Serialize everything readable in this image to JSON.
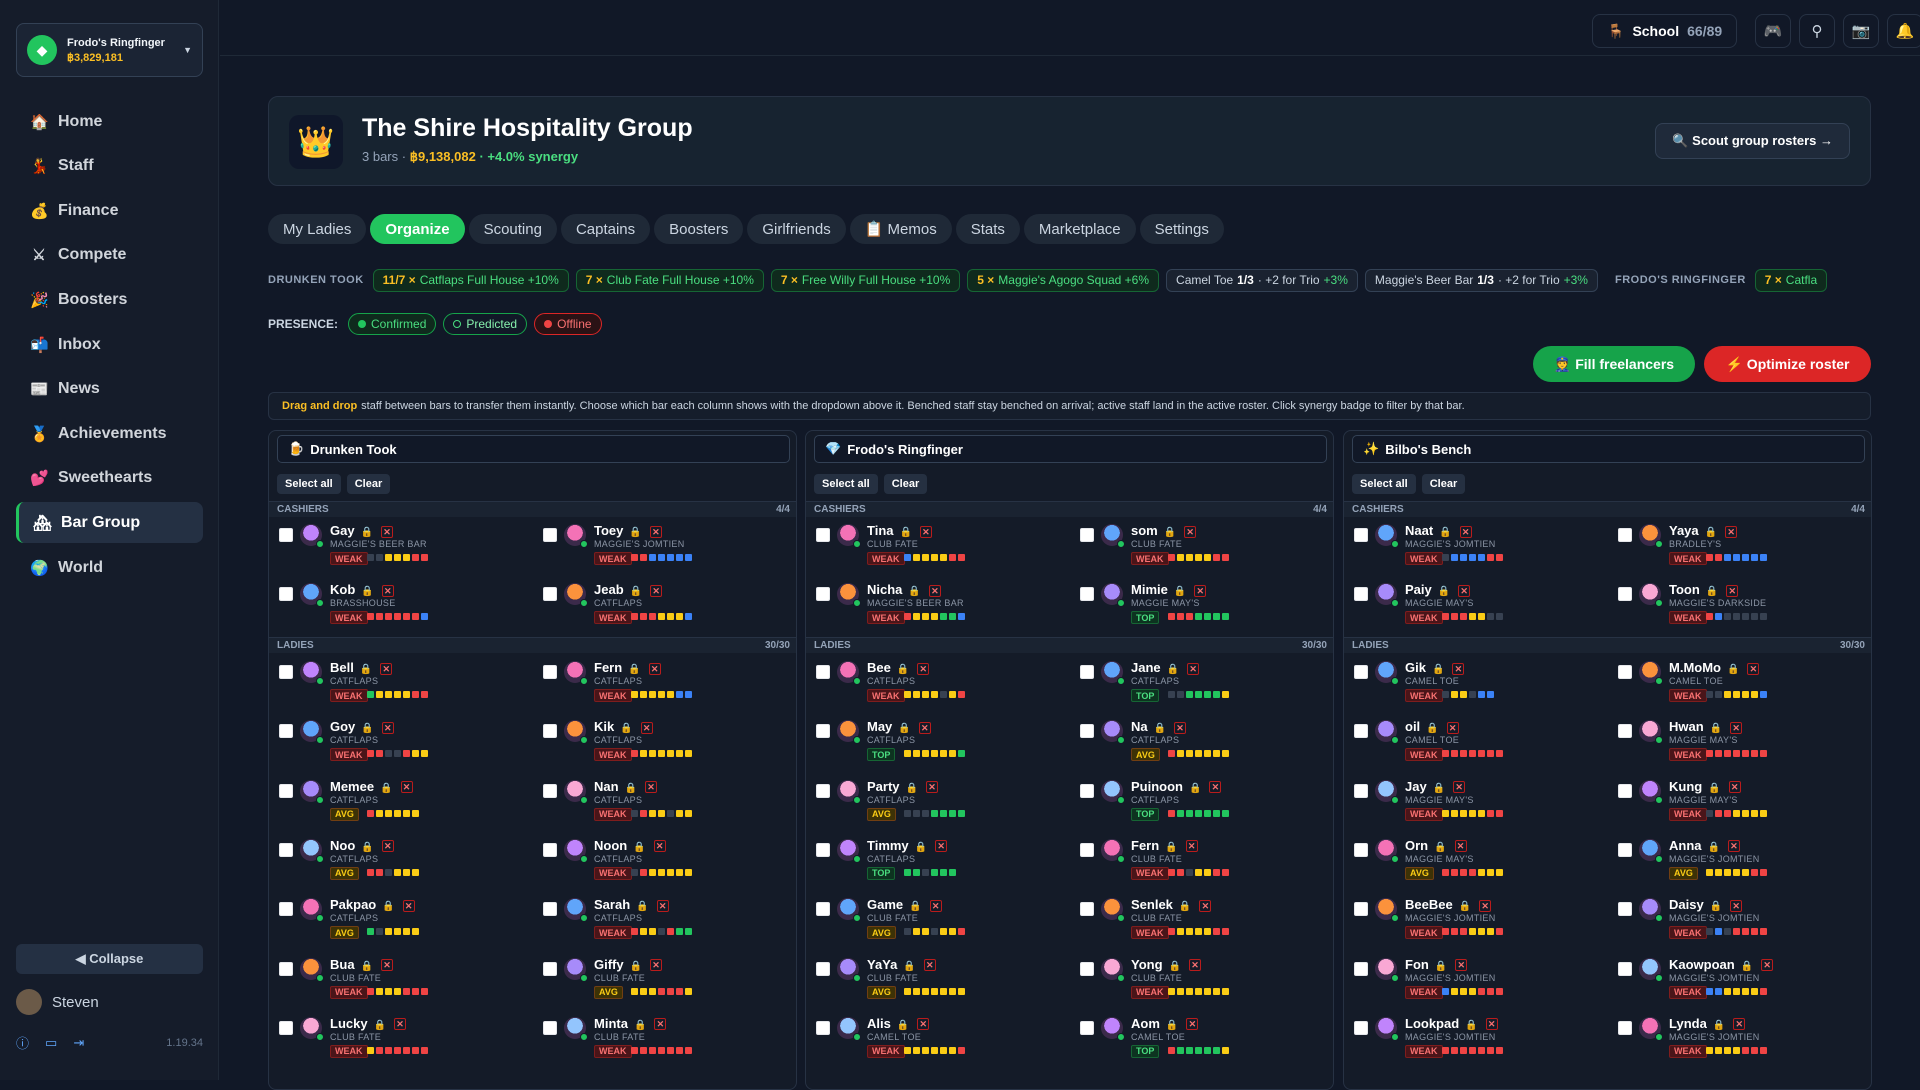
{
  "account": {
    "name": "Frodo's Ringfinger",
    "balance": "฿3,829,181"
  },
  "nav": [
    {
      "label": "Home",
      "icon": "🏠"
    },
    {
      "label": "Staff",
      "icon": "💃"
    },
    {
      "label": "Finance",
      "icon": "💰"
    },
    {
      "label": "Compete",
      "icon": "⚔"
    },
    {
      "label": "Boosters",
      "icon": "🎉"
    },
    {
      "label": "Inbox",
      "icon": "📬"
    },
    {
      "label": "News",
      "icon": "📰"
    },
    {
      "label": "Achievements",
      "icon": "🏅"
    },
    {
      "label": "Sweethearts",
      "icon": "💕"
    },
    {
      "label": "Bar Group",
      "icon": "🏘",
      "active": true
    },
    {
      "label": "World",
      "icon": "🌍"
    }
  ],
  "sidebar": {
    "collapse": "◀ Collapse",
    "user": "Steven",
    "version": "1.19.34"
  },
  "topbar": {
    "school_label": "School",
    "school_count": "66/89"
  },
  "hero": {
    "title": "The Shire Hospitality Group",
    "bars": "3 bars ·",
    "value": "฿9,138,082",
    "synergy": "· +4.0% synergy",
    "scout": "🔍 Scout group rosters →"
  },
  "tabs": [
    "My Ladies",
    "Organize",
    "Scouting",
    "Captains",
    "Boosters",
    "Girlfriends",
    "📋 Memos",
    "Stats",
    "Marketplace",
    "Settings"
  ],
  "active_tab": "Organize",
  "synergy": {
    "label": "DRUNKEN TOOK",
    "chips": [
      {
        "count": "11/7 ×",
        "name": "Catflaps Full House +10%",
        "type": "full"
      },
      {
        "count": "7 ×",
        "name": "Club Fate Full House +10%",
        "type": "full"
      },
      {
        "count": "7 ×",
        "name": "Free Willy Full House +10%",
        "type": "full"
      },
      {
        "count": "5 ×",
        "name": "Maggie's Agogo Squad +6%",
        "type": "full"
      },
      {
        "name": "Camel Toe",
        "frac": "1/3",
        "rest": "· +2 for Trio",
        "pct": "+3%",
        "type": "part"
      },
      {
        "name": "Maggie's Beer Bar",
        "frac": "1/3",
        "rest": "· +2 for Trio",
        "pct": "+3%",
        "type": "part"
      }
    ],
    "label2": "FRODO'S RINGFINGER",
    "chip2": {
      "count": "7 ×",
      "name": "Catfla"
    }
  },
  "presence": {
    "label": "PRESENCE:",
    "items": [
      "Confirmed",
      "Predicted",
      "Offline"
    ]
  },
  "actions": {
    "fill": "👮 Fill freelancers",
    "optimize": "⚡ Optimize roster"
  },
  "info": {
    "bold": "Drag and drop",
    "text": "staff between bars to transfer them instantly. Choose which bar each column shows with the dropdown above it. Benched staff stay benched on arrival; active staff land in the active roster. Click synergy badge to filter by that bar."
  },
  "columns": [
    {
      "title": "Drunken Took",
      "icon": "🍺",
      "select_all": "Select all",
      "clear": "Clear",
      "cashiers_label": "CASHIERS",
      "cashiers_count": "4/4",
      "ladies_label": "LADIES",
      "ladies_count": "30/30",
      "cashiers": [
        {
          "name": "Gay",
          "bar": "MAGGIE'S BEER BAR",
          "tier": "WEAK",
          "dots": "kkyyyrr"
        },
        {
          "name": "Toey",
          "bar": "MAGGIE'S JOMTIEN",
          "tier": "WEAK",
          "dots": "rrbbbbb"
        },
        {
          "name": "Kob",
          "bar": "BRASSHOUSE",
          "tier": "WEAK",
          "dots": "rrrrrrb"
        },
        {
          "name": "Jeab",
          "bar": "CATFLAPS",
          "tier": "WEAK",
          "dots": "rrryyyb"
        }
      ],
      "ladies": [
        {
          "name": "Bell",
          "bar": "CATFLAPS",
          "tier": "WEAK",
          "dots": "gyyyyrr"
        },
        {
          "name": "Fern",
          "bar": "CATFLAPS",
          "tier": "WEAK",
          "dots": "yyyyybb"
        },
        {
          "name": "Goy",
          "bar": "CATFLAPS",
          "tier": "WEAK",
          "dots": "rrkkryy"
        },
        {
          "name": "Kik",
          "bar": "CATFLAPS",
          "tier": "WEAK",
          "dots": "ryyyyyy"
        },
        {
          "name": "Memee",
          "bar": "CATFLAPS",
          "tier": "AVG",
          "dots": "ryyyyy"
        },
        {
          "name": "Nan",
          "bar": "CATFLAPS",
          "tier": "WEAK",
          "dots": "kryykyy"
        },
        {
          "name": "Noo",
          "bar": "CATFLAPS",
          "tier": "AVG",
          "dots": "rrkyyy"
        },
        {
          "name": "Noon",
          "bar": "CATFLAPS",
          "tier": "WEAK",
          "dots": "kryyyyy"
        },
        {
          "name": "Pakpao",
          "bar": "CATFLAPS",
          "tier": "AVG",
          "dots": "gkyyyy"
        },
        {
          "name": "Sarah",
          "bar": "CATFLAPS",
          "tier": "WEAK",
          "dots": "ryykrgg"
        },
        {
          "name": "Bua",
          "bar": "CLUB FATE",
          "tier": "WEAK",
          "dots": "ryyyrrr"
        },
        {
          "name": "Giffy",
          "bar": "CLUB FATE",
          "tier": "AVG",
          "dots": "yyyrrry"
        },
        {
          "name": "Lucky",
          "bar": "CLUB FATE",
          "tier": "WEAK",
          "dots": "yrrrrrr"
        },
        {
          "name": "Minta",
          "bar": "CLUB FATE",
          "tier": "WEAK",
          "dots": "rrrrrrr"
        }
      ]
    },
    {
      "title": "Frodo's Ringfinger",
      "icon": "💎",
      "select_all": "Select all",
      "clear": "Clear",
      "cashiers_label": "CASHIERS",
      "cashiers_count": "4/4",
      "ladies_label": "LADIES",
      "ladies_count": "30/30",
      "cashiers": [
        {
          "name": "Tina",
          "bar": "CLUB FATE",
          "tier": "WEAK",
          "dots": "byyyyrr"
        },
        {
          "name": "som",
          "bar": "CLUB FATE",
          "tier": "WEAK",
          "dots": "ryyyyrr"
        },
        {
          "name": "Nicha",
          "bar": "MAGGIE'S BEER BAR",
          "tier": "WEAK",
          "dots": "ryyyggb"
        },
        {
          "name": "Mimie",
          "bar": "MAGGIE MAY'S",
          "tier": "TOP",
          "dots": "rrrgggg"
        }
      ],
      "ladies": [
        {
          "name": "Bee",
          "bar": "CATFLAPS",
          "tier": "WEAK",
          "dots": "yyyykyr"
        },
        {
          "name": "Jane",
          "bar": "CATFLAPS",
          "tier": "TOP",
          "dots": "kkggggy"
        },
        {
          "name": "May",
          "bar": "CATFLAPS",
          "tier": "TOP",
          "dots": "yyyyyyg"
        },
        {
          "name": "Na",
          "bar": "CATFLAPS",
          "tier": "AVG",
          "dots": "ryyyyyy"
        },
        {
          "name": "Party",
          "bar": "CATFLAPS",
          "tier": "AVG",
          "dots": "kkkgggg"
        },
        {
          "name": "Puinoon",
          "bar": "CATFLAPS",
          "tier": "TOP",
          "dots": "rgggggg"
        },
        {
          "name": "Timmy",
          "bar": "CATFLAPS",
          "tier": "TOP",
          "dots": "ggkggg"
        },
        {
          "name": "Fern",
          "bar": "CLUB FATE",
          "tier": "WEAK",
          "dots": "rrkyyrr"
        },
        {
          "name": "Game",
          "bar": "CLUB FATE",
          "tier": "AVG",
          "dots": "kyykyyr"
        },
        {
          "name": "Senlek",
          "bar": "CLUB FATE",
          "tier": "WEAK",
          "dots": "ryyyyrr"
        },
        {
          "name": "YaYa",
          "bar": "CLUB FATE",
          "tier": "AVG",
          "dots": "yyyyyyy"
        },
        {
          "name": "Yong",
          "bar": "CLUB FATE",
          "tier": "WEAK",
          "dots": "yyyyyyy"
        },
        {
          "name": "Alis",
          "bar": "CAMEL TOE",
          "tier": "WEAK",
          "dots": "yyyyyyr"
        },
        {
          "name": "Aom",
          "bar": "CAMEL TOE",
          "tier": "TOP",
          "dots": "rgggggy"
        }
      ]
    },
    {
      "title": "Bilbo's Bench",
      "icon": "✨",
      "select_all": "Select all",
      "clear": "Clear",
      "cashiers_label": "CASHIERS",
      "cashiers_count": "4/4",
      "ladies_label": "LADIES",
      "ladies_count": "30/30",
      "cashiers": [
        {
          "name": "Naat",
          "bar": "MAGGIE'S JOMTIEN",
          "tier": "WEAK",
          "dots": "kbbbbrr"
        },
        {
          "name": "Yaya",
          "bar": "BRADLEY'S",
          "tier": "WEAK",
          "dots": "rrbbbbb"
        },
        {
          "name": "Paiy",
          "bar": "MAGGIE MAY'S",
          "tier": "WEAK",
          "dots": "rrryykk"
        },
        {
          "name": "Toon",
          "bar": "MAGGIE'S DARKSIDE",
          "tier": "WEAK",
          "dots": "rbkkkkk"
        }
      ],
      "ladies": [
        {
          "name": "Gik",
          "bar": "CAMEL TOE",
          "tier": "WEAK",
          "dots": "kyykbb"
        },
        {
          "name": "M.MoMo",
          "bar": "CAMEL TOE",
          "tier": "WEAK",
          "dots": "kkyyyyb"
        },
        {
          "name": "oil",
          "bar": "CAMEL TOE",
          "tier": "WEAK",
          "dots": "rrrrrrr"
        },
        {
          "name": "Hwan",
          "bar": "MAGGIE MAY'S",
          "tier": "WEAK",
          "dots": "rrrrrrr"
        },
        {
          "name": "Jay",
          "bar": "MAGGIE MAY'S",
          "tier": "WEAK",
          "dots": "yyyyyrr"
        },
        {
          "name": "Kung",
          "bar": "MAGGIE MAY'S",
          "tier": "WEAK",
          "dots": "krryyyy"
        },
        {
          "name": "Orn",
          "bar": "MAGGIE MAY'S",
          "tier": "AVG",
          "dots": "rrrryyy"
        },
        {
          "name": "Anna",
          "bar": "MAGGIE'S JOMTIEN",
          "tier": "AVG",
          "dots": "yyyyyrr"
        },
        {
          "name": "BeeBee",
          "bar": "MAGGIE'S JOMTIEN",
          "tier": "WEAK",
          "dots": "rrryyyr"
        },
        {
          "name": "Daisy",
          "bar": "MAGGIE'S JOMTIEN",
          "tier": "WEAK",
          "dots": "kbkrrrr"
        },
        {
          "name": "Fon",
          "bar": "MAGGIE'S JOMTIEN",
          "tier": "WEAK",
          "dots": "byyyrrr"
        },
        {
          "name": "Kaowpoan",
          "bar": "MAGGIE'S JOMTIEN",
          "tier": "WEAK",
          "dots": "bbyyyyr"
        },
        {
          "name": "Lookpad",
          "bar": "MAGGIE'S JOMTIEN",
          "tier": "WEAK",
          "dots": "rrrrrrr"
        },
        {
          "name": "Lynda",
          "bar": "MAGGIE'S JOMTIEN",
          "tier": "WEAK",
          "dots": "yyyyrrr"
        }
      ]
    }
  ],
  "colors": {
    "accent": "#22c55e",
    "danger": "#dc2626",
    "gold": "#fbbf24",
    "dot_r": "#ef4444",
    "dot_y": "#facc15",
    "dot_g": "#22c55e",
    "dot_b": "#3b82f6",
    "dot_k": "#374151"
  }
}
